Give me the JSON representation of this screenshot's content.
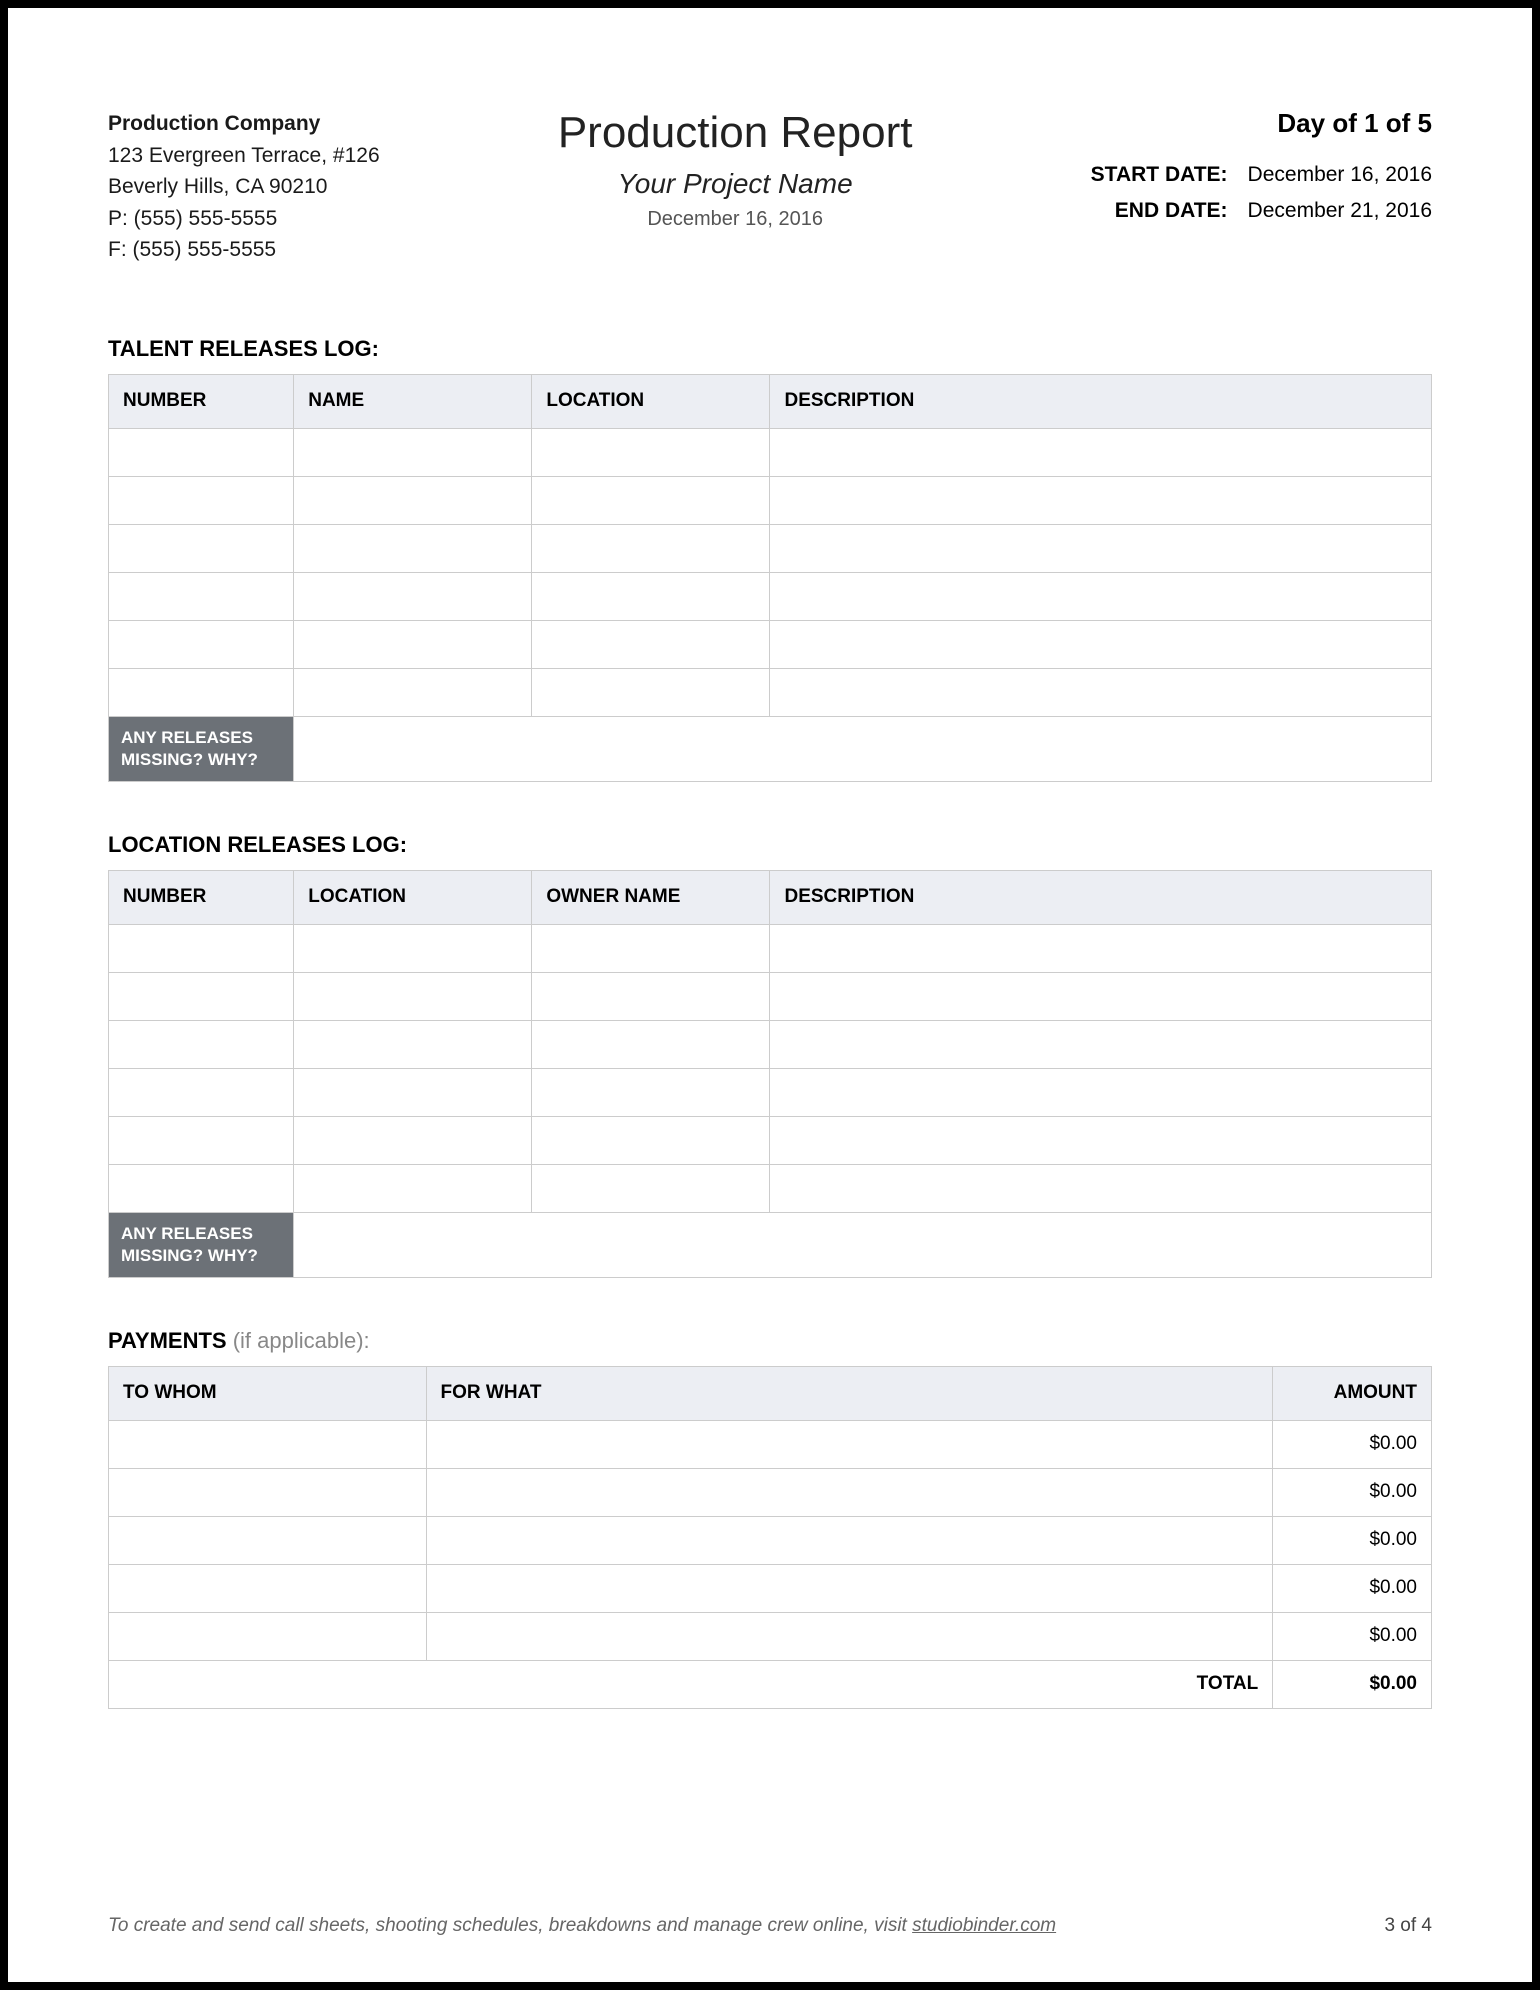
{
  "header": {
    "company": {
      "name": "Production Company",
      "address1": "123 Evergreen Terrace, #126",
      "address2": "Beverly Hills, CA 90210",
      "phone": "P: (555) 555-5555",
      "fax": "F: (555) 555-5555"
    },
    "title": "Production Report",
    "project": "Your Project Name",
    "reportDate": "December 16, 2016",
    "day": "Day of 1 of 5",
    "startLabel": "START DATE:",
    "startDate": "December 16, 2016",
    "endLabel": "END DATE:",
    "endDate": "December 21, 2016"
  },
  "talent": {
    "title": "TALENT RELEASES LOG:",
    "cols": [
      "NUMBER",
      "NAME",
      "LOCATION",
      "DESCRIPTION"
    ],
    "rows": [
      [
        "",
        "",
        "",
        ""
      ],
      [
        "",
        "",
        "",
        ""
      ],
      [
        "",
        "",
        "",
        ""
      ],
      [
        "",
        "",
        "",
        ""
      ],
      [
        "",
        "",
        "",
        ""
      ],
      [
        "",
        "",
        "",
        ""
      ]
    ],
    "footerLabel": "ANY RELEASES MISSING? WHY?",
    "footerValue": ""
  },
  "location": {
    "title": "LOCATION RELEASES LOG:",
    "cols": [
      "NUMBER",
      "LOCATION",
      "OWNER NAME",
      "DESCRIPTION"
    ],
    "rows": [
      [
        "",
        "",
        "",
        ""
      ],
      [
        "",
        "",
        "",
        ""
      ],
      [
        "",
        "",
        "",
        ""
      ],
      [
        "",
        "",
        "",
        ""
      ],
      [
        "",
        "",
        "",
        ""
      ],
      [
        "",
        "",
        "",
        ""
      ]
    ],
    "footerLabel": "ANY RELEASES MISSING? WHY?",
    "footerValue": ""
  },
  "payments": {
    "titleBold": "PAYMENTS",
    "titleLight": "  (if applicable):",
    "cols": [
      "TO WHOM",
      "FOR WHAT",
      "AMOUNT"
    ],
    "rows": [
      [
        "",
        "",
        "$0.00"
      ],
      [
        "",
        "",
        "$0.00"
      ],
      [
        "",
        "",
        "$0.00"
      ],
      [
        "",
        "",
        "$0.00"
      ],
      [
        "",
        "",
        "$0.00"
      ]
    ],
    "totalLabel": "TOTAL",
    "totalValue": "$0.00"
  },
  "footer": {
    "text": "To create and send call sheets, shooting schedules, breakdowns and manage crew online, visit ",
    "link": "studiobinder.com",
    "page": "3 of 4"
  }
}
